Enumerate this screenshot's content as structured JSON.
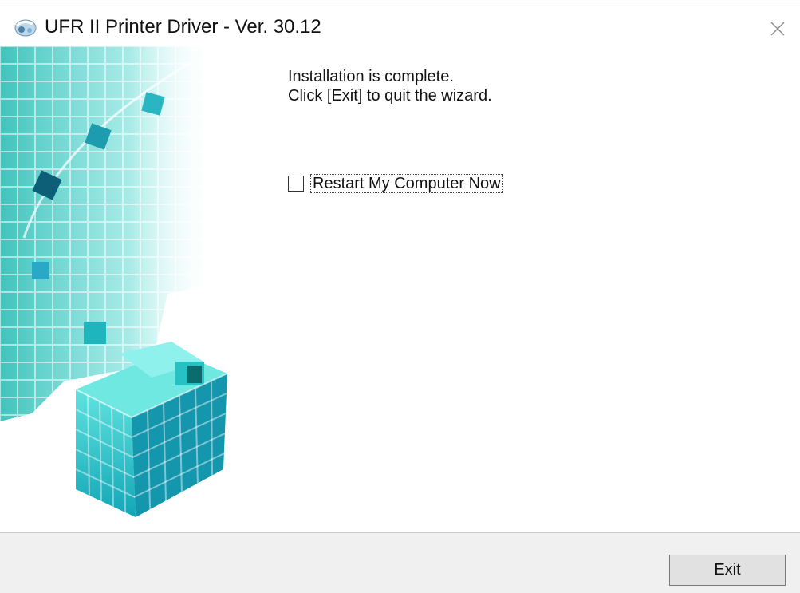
{
  "window": {
    "title": "UFR II Printer Driver - Ver. 30.12"
  },
  "message": {
    "line1": "Installation is complete.",
    "line2": "Click [Exit] to quit the wizard."
  },
  "options": {
    "restart_label": "Restart My Computer Now",
    "restart_checked": false
  },
  "footer": {
    "exit_label": "Exit"
  },
  "icons": {
    "app": "printer-driver-icon",
    "close": "close-icon",
    "art": "cube-artwork"
  },
  "colors": {
    "accent_teal": "#2fc3c3",
    "footer_bg": "#f0f0f0",
    "button_bg": "#e1e1e1"
  }
}
